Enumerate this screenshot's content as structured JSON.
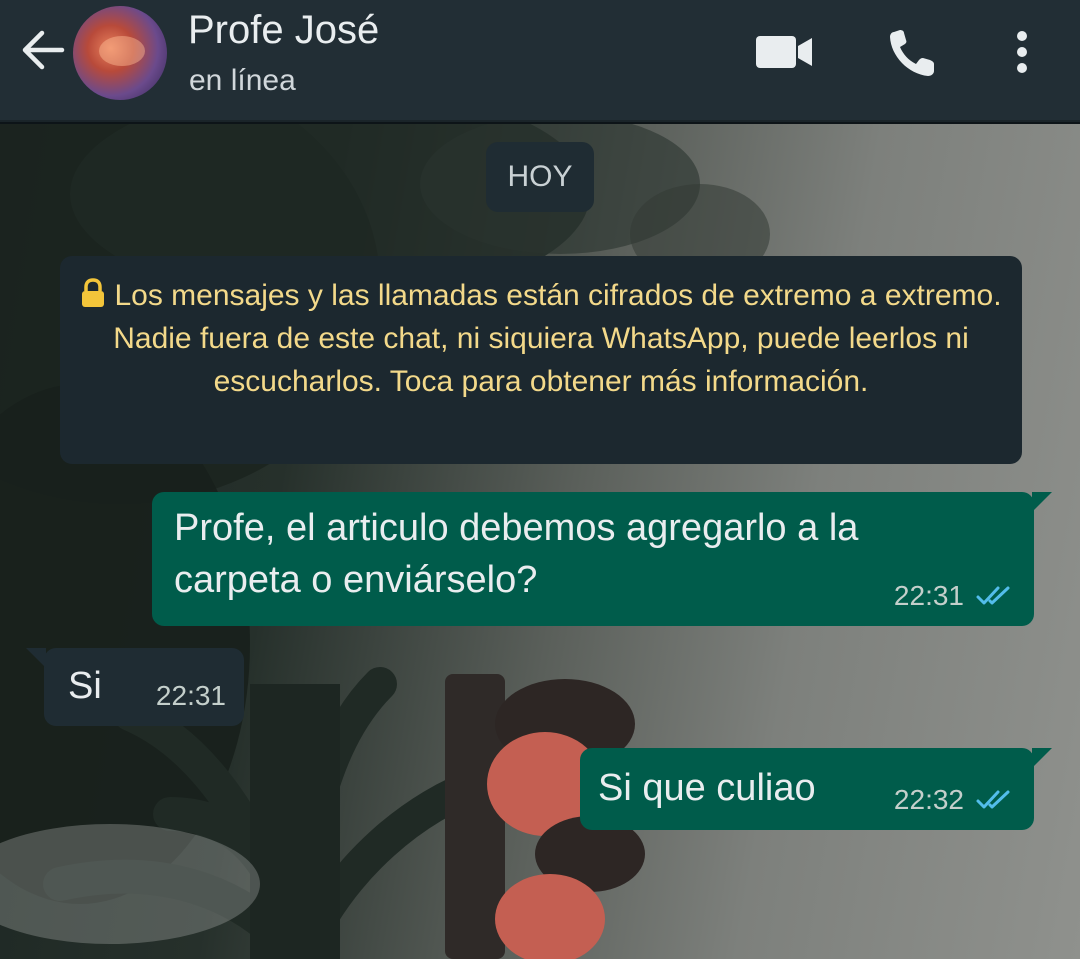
{
  "header": {
    "contact_name": "Profe José",
    "status": "en línea",
    "icons": [
      "back-arrow-icon",
      "video-call-icon",
      "phone-call-icon",
      "more-options-icon"
    ]
  },
  "chat": {
    "date_label": "HOY",
    "encryption_notice": "Los mensajes y las llamadas están cifrados de extremo a extremo. Nadie fuera de este chat, ni siquiera WhatsApp, puede leerlos ni escucharlos. Toca para obtener más información.",
    "messages": [
      {
        "direction": "outgoing",
        "text": "Profe, el articulo debemos agregarlo a la carpeta o enviárselo?",
        "time": "22:31",
        "status": "read"
      },
      {
        "direction": "incoming",
        "text": "Si",
        "time": "22:31"
      },
      {
        "direction": "outgoing",
        "text": "Si que culiao",
        "time": "22:32",
        "status": "read"
      }
    ]
  },
  "colors": {
    "header_bg": "#222e35",
    "outgoing_bubble": "#005c4b",
    "incoming_bubble": "#1f2c33",
    "notice_text": "#f3d98a",
    "read_ticks": "#53bdeb"
  }
}
